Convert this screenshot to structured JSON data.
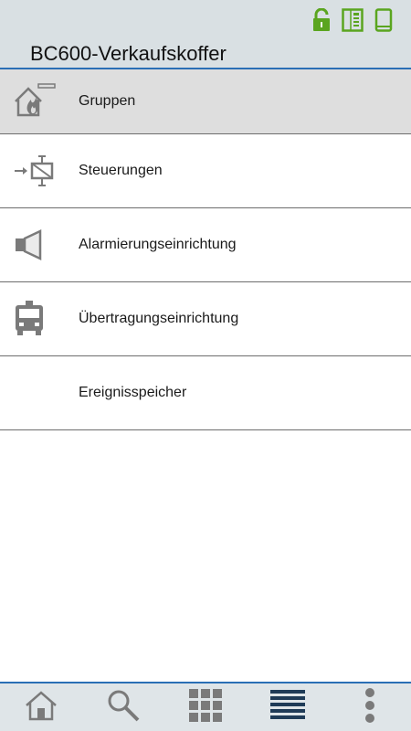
{
  "header": {
    "title": "BC600-Verkaufskoffer",
    "status_icons": [
      "lock-open-icon",
      "panel-icon",
      "phone-icon"
    ],
    "accent_color": "#5aa51f",
    "divider_color": "#2a6fb5"
  },
  "menu": {
    "items": [
      {
        "label": "Gruppen",
        "icon": "house-fire-icon",
        "active": true
      },
      {
        "label": "Steuerungen",
        "icon": "relay-control-icon",
        "active": false
      },
      {
        "label": "Alarmierungseinrichtung",
        "icon": "speaker-icon",
        "active": false
      },
      {
        "label": "Übertragungseinrichtung",
        "icon": "fire-truck-icon",
        "active": false
      },
      {
        "label": "Ereignisspeicher",
        "icon": "",
        "active": false
      }
    ]
  },
  "bottom_bar": {
    "tabs": [
      "home-icon",
      "search-icon",
      "grid-icon",
      "list-icon",
      "more-icon"
    ]
  }
}
